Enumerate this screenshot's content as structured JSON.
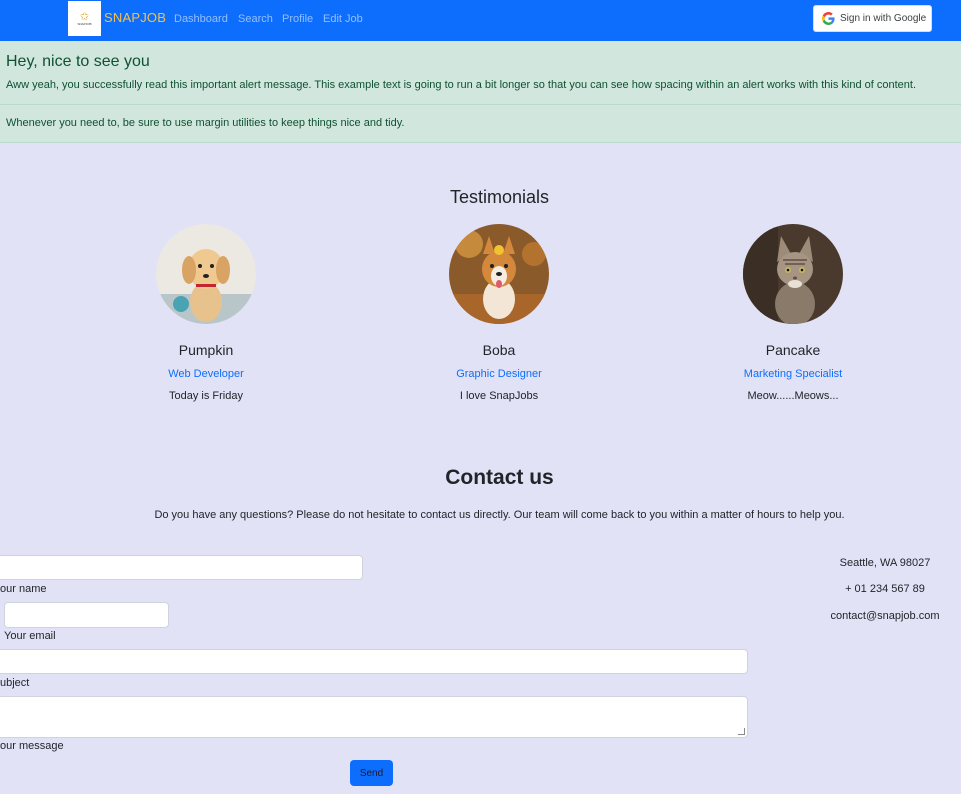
{
  "navbar": {
    "brand": "SNAPJOB",
    "links": [
      "Dashboard",
      "Search",
      "Profile",
      "Edit Job"
    ],
    "google_button": "Sign in with Google"
  },
  "alert": {
    "heading": "Hey, nice to see you",
    "text": "Aww yeah, you successfully read this important alert message. This example text is going to run a bit longer so that you can see how spacing within an alert works with this kind of content.",
    "note": "Whenever you need to, be sure to use margin utilities to keep things nice and tidy."
  },
  "testimonials": {
    "title": "Testimonials",
    "items": [
      {
        "name": "Pumpkin",
        "role": "Web Developer",
        "quote": "Today is Friday"
      },
      {
        "name": "Boba",
        "role": "Graphic Designer",
        "quote": "I love SnapJobs"
      },
      {
        "name": "Pancake",
        "role": "Marketing Specialist",
        "quote": "Meow......Meows..."
      }
    ]
  },
  "contact": {
    "title": "Contact us",
    "description": "Do you have any questions? Please do not hesitate to contact us directly. Our team will come back to you within a matter of hours to help you.",
    "labels": {
      "name": "our name",
      "email": "Your email",
      "subject": "ubject",
      "message": "our message"
    },
    "send": "Send",
    "info": {
      "location": "Seattle, WA 98027",
      "phone": "+ 01 234 567 89",
      "email": "contact@snapjob.com"
    }
  },
  "colors": {
    "primary": "#0d6efd",
    "alert_bg": "#d1e7dd",
    "page_bg": "#e2e2f6"
  }
}
